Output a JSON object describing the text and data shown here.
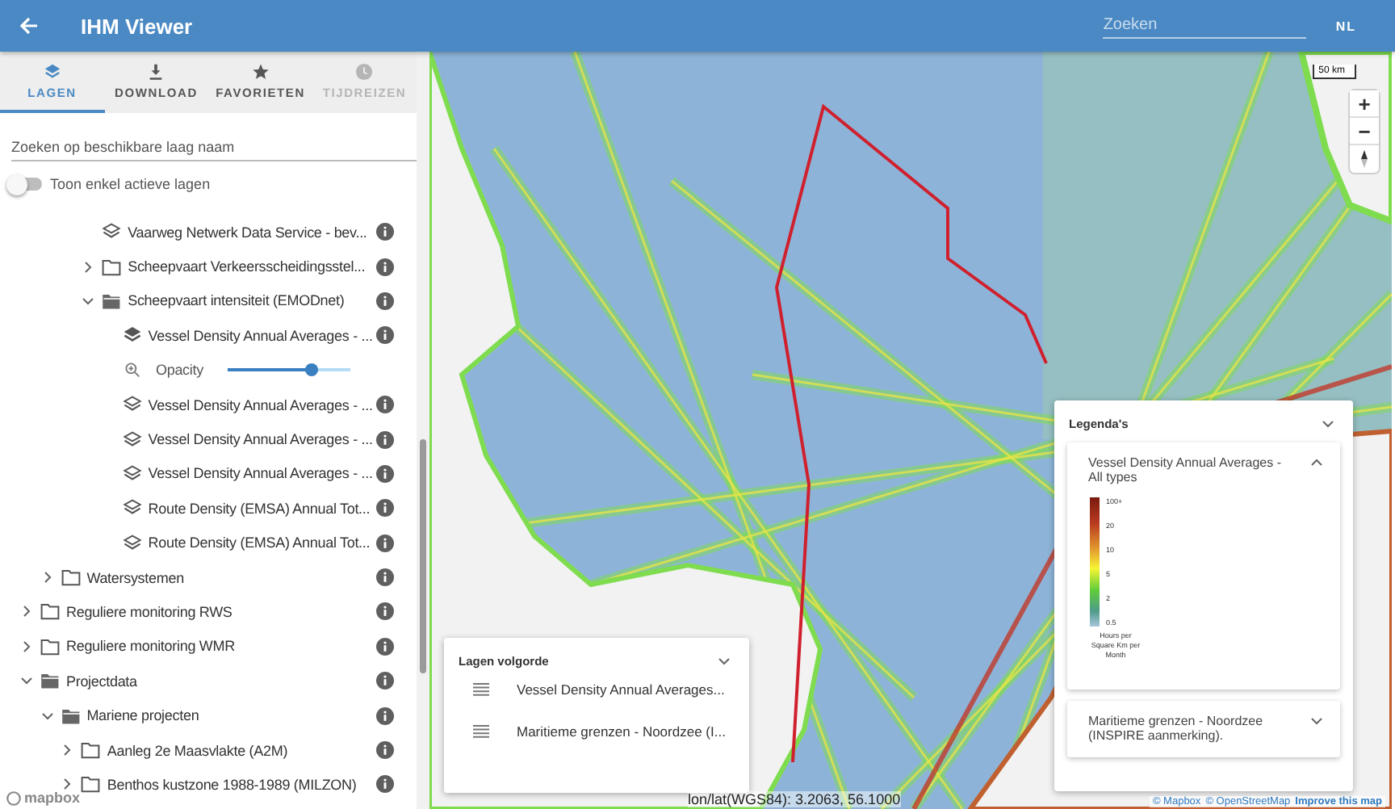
{
  "header": {
    "title": "IHM Viewer",
    "search": {
      "placeholder": "Zoeken"
    },
    "language": "NL"
  },
  "tabs": [
    {
      "label": "LAGEN",
      "selected": true,
      "disabled": false
    },
    {
      "label": "DOWNLOAD",
      "selected": false,
      "disabled": false
    },
    {
      "label": "FAVORIETEN",
      "selected": false,
      "disabled": false
    },
    {
      "label": "TIJDREIZEN",
      "selected": false,
      "disabled": true
    }
  ],
  "layer_search": {
    "placeholder": "Zoeken op beschikbare laag naam"
  },
  "active_toggle": {
    "label": "Toon enkel actieve lagen",
    "on": false
  },
  "tree": [
    {
      "children": [
        {
          "children": [
            {
              "children": [
                {
                  "kind": "layer",
                  "label": "Vaarweg Netwerk Data Service - bev...",
                  "active": false
                },
                {
                  "kind": "folder",
                  "label": "Scheepvaart Verkeersscheidingsstel...",
                  "expanded": false
                },
                {
                  "kind": "folder",
                  "label": "Scheepvaart intensiteit (EMODnet)",
                  "expanded": true,
                  "children": [
                    {
                      "kind": "layer",
                      "label": "Vessel Density Annual Averages - ...",
                      "active": true,
                      "opacity": {
                        "label": "Opacity",
                        "level": 0.68
                      }
                    },
                    {
                      "kind": "layer",
                      "label": "Vessel Density Annual Averages - ...",
                      "active": false
                    },
                    {
                      "kind": "layer",
                      "label": "Vessel Density Annual Averages - ...",
                      "active": false
                    },
                    {
                      "kind": "layer",
                      "label": "Vessel Density Annual Averages - ...",
                      "active": false
                    },
                    {
                      "kind": "layer",
                      "label": "Route Density (EMSA) Annual Tot...",
                      "active": false
                    },
                    {
                      "kind": "layer",
                      "label": "Route Density (EMSA) Annual Tot...",
                      "active": false
                    }
                  ]
                }
              ]
            }
          ]
        },
        {
          "kind": "folder",
          "label": "Watersystemen",
          "expanded": false
        }
      ]
    },
    {
      "kind": "folder",
      "label": "Reguliere monitoring RWS",
      "expanded": false
    },
    {
      "kind": "folder",
      "label": "Reguliere monitoring WMR",
      "expanded": false
    },
    {
      "kind": "folder",
      "label": "Projectdata",
      "expanded": true,
      "children": [
        {
          "kind": "folder",
          "label": "Mariene projecten",
          "expanded": true,
          "children": [
            {
              "kind": "folder",
              "label": "Aanleg 2e Maasvlakte (A2M)",
              "expanded": false
            },
            {
              "kind": "folder",
              "label": "Benthos kustzone 1988-1989 (MILZON)",
              "expanded": false
            }
          ]
        }
      ]
    }
  ],
  "map": {
    "scale": "50 km",
    "zoom_in": "+",
    "zoom_out": "−",
    "logo": "mapbox",
    "coordinates": "lon/lat(WGS84): 3.2063, 56.1000",
    "attribution": [
      {
        "text": "© Mapbox",
        "kind": "link"
      },
      {
        "text": "© OpenStreetMap",
        "kind": "link"
      },
      {
        "text": "Improve this map",
        "kind": "strong"
      }
    ]
  },
  "layer_order": {
    "title": "Lagen volgorde",
    "expanded": true,
    "items": [
      "Vessel Density Annual Averages...",
      "Maritieme grenzen - Noordzee (I..."
    ]
  },
  "legend": {
    "title": "Legenda's",
    "expanded": true,
    "cards": [
      {
        "title": "Vessel Density Annual Averages - All types",
        "expanded": true,
        "scale_labels": [
          "100+",
          "20",
          "10",
          "5",
          "2",
          "0.5"
        ],
        "unit": "Hours per Square Km per Month"
      },
      {
        "title": "Maritieme grenzen - Noordzee (INSPIRE aanmerking).",
        "expanded": false
      }
    ]
  }
}
